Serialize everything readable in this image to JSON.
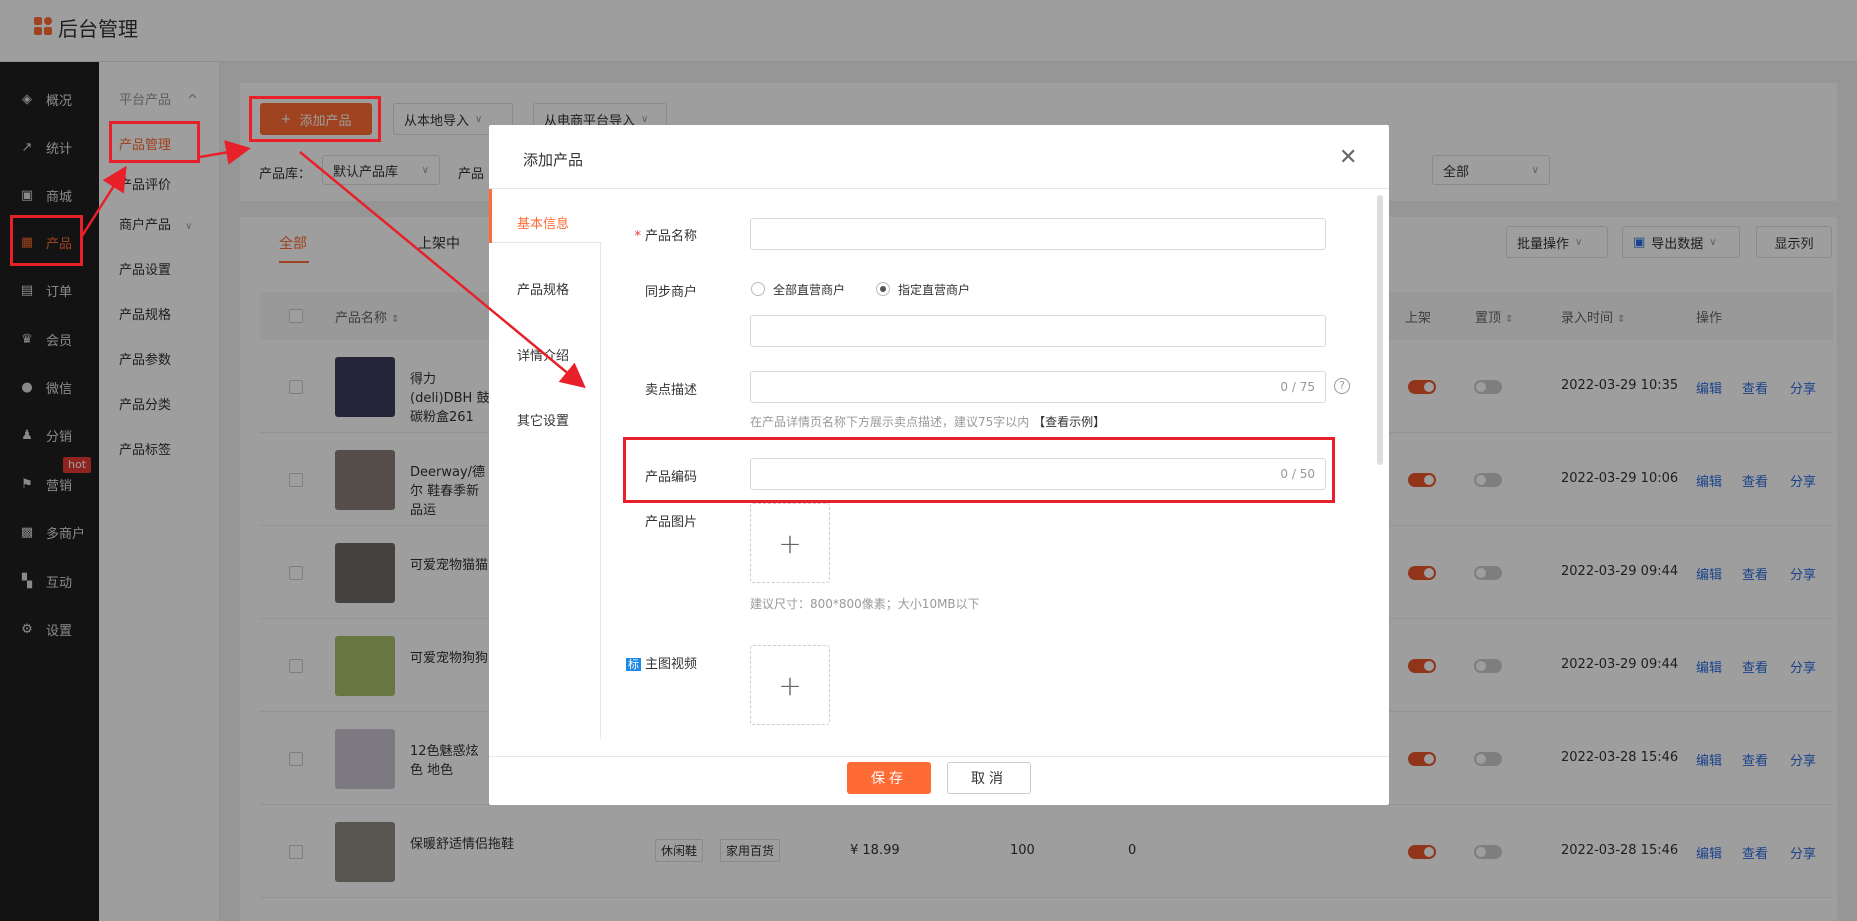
{
  "app": {
    "title": "后台管理"
  },
  "sidebar": {
    "items": [
      {
        "label": "概况",
        "icon": "layers-icon"
      },
      {
        "label": "统计",
        "icon": "chart-icon"
      },
      {
        "label": "商城",
        "icon": "store-icon"
      },
      {
        "label": "产品",
        "icon": "grid-icon",
        "active": true
      },
      {
        "label": "订单",
        "icon": "clipboard-icon"
      },
      {
        "label": "会员",
        "icon": "crown-icon"
      },
      {
        "label": "微信",
        "icon": "wechat-icon"
      },
      {
        "label": "分销",
        "icon": "users-icon"
      },
      {
        "label": "营销",
        "icon": "flag-icon"
      },
      {
        "label": "多商户",
        "icon": "shop-icon"
      },
      {
        "label": "互动",
        "icon": "apps-icon"
      },
      {
        "label": "设置",
        "icon": "gear-icon"
      }
    ],
    "hot_badge": "hot"
  },
  "submenu": {
    "items": [
      "平台产品",
      "产品管理",
      "产品评价",
      "商户产品",
      "产品设置",
      "产品规格",
      "产品参数",
      "产品分类",
      "产品标签"
    ]
  },
  "toolbar": {
    "add": "添加产品",
    "import_local": "从本地导入",
    "import_platform": "从电商平台导入",
    "lib_label": "产品库：",
    "lib_value": "默认产品库",
    "prod_label": "产品",
    "all_select": "全部"
  },
  "tabs": [
    "全部",
    "上架中"
  ],
  "actions": {
    "batch": "批量操作",
    "export": "导出数据",
    "columns": "显示列"
  },
  "table": {
    "headers": {
      "name": "产品名称",
      "shelf": "上架",
      "top": "置顶",
      "time": "录入时间",
      "ops": "操作"
    },
    "rows": [
      {
        "name": "得力(deli)DBH 鼓 碳粉盒261",
        "time": "2022-03-29 10:35"
      },
      {
        "name": "Deerway/德尔 鞋春季新品运",
        "time": "2022-03-29 10:06"
      },
      {
        "name": "可爱宠物猫猫",
        "time": "2022-03-29 09:44"
      },
      {
        "name": "可爱宠物狗狗",
        "time": "2022-03-29 09:44"
      },
      {
        "name": "12色魅惑炫色 地色",
        "time": "2022-03-28 15:46"
      },
      {
        "name": "保暖舒适情侣拖鞋",
        "time": "2022-03-28 15:46",
        "tags": [
          "休闲鞋",
          "家用百货"
        ],
        "price": "¥ 18.99",
        "stock": "100",
        "sales": "0"
      }
    ],
    "op_labels": {
      "edit": "编辑",
      "view": "查看",
      "share": "分享"
    }
  },
  "dialog": {
    "title": "添加产品",
    "nav": [
      "基本信息",
      "产品规格",
      "详情介绍",
      "其它设置"
    ],
    "fields": {
      "name_label": "产品名称",
      "sync_label": "同步商户",
      "radio_all": "全部直营商户",
      "radio_assign": "指定直营商户",
      "selling_label": "卖点描述",
      "selling_count": "0 / 75",
      "selling_hint": "在产品详情页名称下方展示卖点描述，建议75字以内",
      "selling_example": "【查看示例】",
      "code_label": "产品编码",
      "code_count": "0 / 50",
      "image_label": "产品图片",
      "image_hint": "建议尺寸：800*800像素；大小10MB以下",
      "video_label": "主图视频",
      "video_badge": "标"
    },
    "save": "保存",
    "cancel": "取消"
  },
  "colors": {
    "accent": "#ff6b35",
    "annotation": "#e8202a",
    "link": "#2b6de0"
  }
}
